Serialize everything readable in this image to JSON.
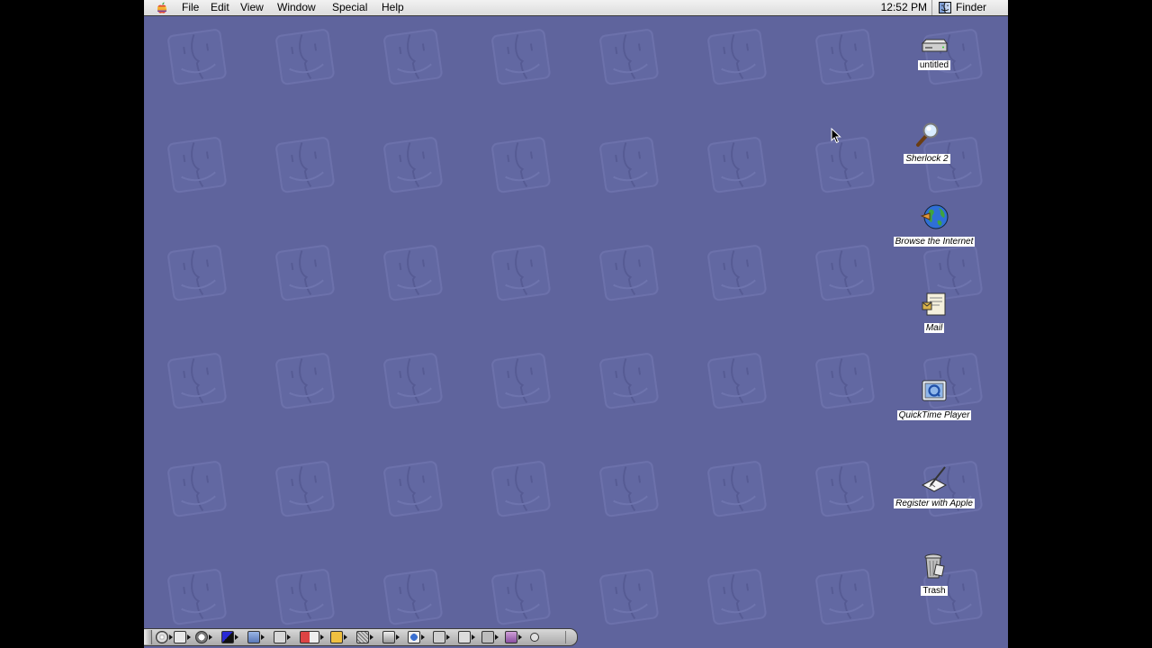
{
  "menubar": {
    "apple_icon": "apple-menu-icon",
    "menus": [
      "File",
      "Edit",
      "View",
      "Window",
      "Special",
      "Help"
    ],
    "clock": "12:52 PM",
    "active_app": "Finder",
    "active_app_icon": "finder-icon"
  },
  "desktop": {
    "background_color": "#5f649d",
    "pattern": "mac-os-face-tiles",
    "icons": [
      {
        "label": "untitled",
        "icon": "hard-disk-icon"
      },
      {
        "label": "Sherlock 2",
        "icon": "sherlock-icon"
      },
      {
        "label": "Browse the Internet",
        "icon": "globe-icon"
      },
      {
        "label": "Mail",
        "icon": "mail-icon"
      },
      {
        "label": "QuickTime Player",
        "icon": "quicktime-icon"
      },
      {
        "label": "Register with Apple",
        "icon": "register-icon"
      },
      {
        "label": "Trash",
        "icon": "trash-icon"
      }
    ]
  },
  "control_strip": {
    "modules": [
      "cd-icon",
      "appletalk-icon",
      "energy-icon",
      "color-depth-icon",
      "file-sharing-icon",
      "keychain-icon",
      "location-icon",
      "monitor-icon",
      "printer-icon",
      "quicktime-icon",
      "remote-access-icon",
      "sound-icon",
      "speech-icon",
      "web-sharing-icon",
      "extensions-icon"
    ]
  },
  "cursor": {
    "icon": "arrow-cursor-icon"
  }
}
